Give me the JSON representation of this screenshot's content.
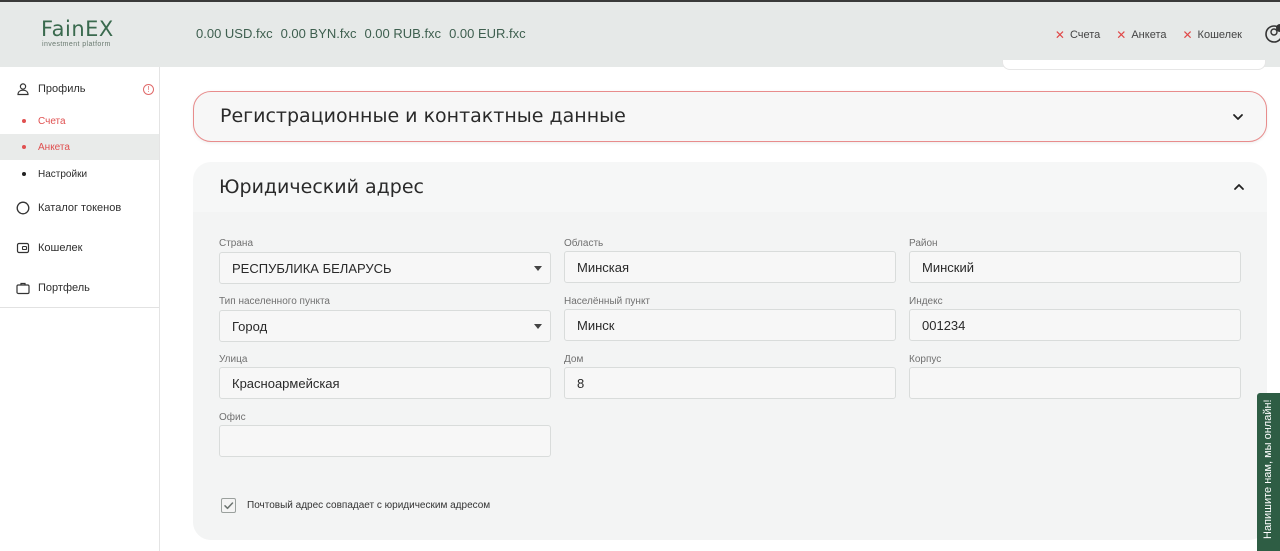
{
  "brand": {
    "name": "FainEX",
    "tagline": "investment platform",
    "accent": "#3a6a4e",
    "error": "#e04848"
  },
  "header": {
    "balances": [
      "0.00 USD.fxc",
      "0.00 BYN.fxc",
      "0.00 RUB.fxc",
      "0.00 EUR.fxc"
    ],
    "status_links": [
      {
        "label": "Счета",
        "icon": "x-icon"
      },
      {
        "label": "Анкета",
        "icon": "x-icon"
      },
      {
        "label": "Кошелек",
        "icon": "x-icon"
      }
    ]
  },
  "sidebar": {
    "profile": {
      "label": "Профиль",
      "icon": "user-icon",
      "alert_glyph": "!"
    },
    "sub_items": [
      {
        "label": "Счета",
        "state": "pending"
      },
      {
        "label": "Анкета",
        "state": "active"
      },
      {
        "label": "Настройки",
        "state": "normal"
      }
    ],
    "items": [
      {
        "label": "Каталог токенов",
        "icon": "circle-icon"
      },
      {
        "label": "Кошелек",
        "icon": "wallet-icon"
      },
      {
        "label": "Портфель",
        "icon": "briefcase-icon"
      }
    ]
  },
  "sections": {
    "registration": {
      "title": "Регистрационные и контактные данные",
      "expanded": false
    },
    "legal_address": {
      "title": "Юридический адрес",
      "expanded": true,
      "fields": {
        "country": {
          "label": "Страна",
          "value": "РЕСПУБЛИКА БЕЛАРУСЬ"
        },
        "region": {
          "label": "Область",
          "value": "Минская"
        },
        "district": {
          "label": "Район",
          "value": "Минский"
        },
        "settlement_type": {
          "label": "Тип населенного пункта",
          "value": "Город"
        },
        "settlement": {
          "label": "Населённый пункт",
          "value": "Минск"
        },
        "postcode": {
          "label": "Индекс",
          "value": "001234"
        },
        "street": {
          "label": "Улица",
          "value": "Красноармейская"
        },
        "house": {
          "label": "Дом",
          "value": "8"
        },
        "building": {
          "label": "Корпус",
          "value": ""
        },
        "office": {
          "label": "Офис",
          "value": ""
        }
      },
      "postal_same": {
        "label": "Почтовый адрес совпадает с юридическим адресом",
        "checked": true
      }
    }
  },
  "side_tab": {
    "label": "Напишите нам, мы онлайн!"
  }
}
